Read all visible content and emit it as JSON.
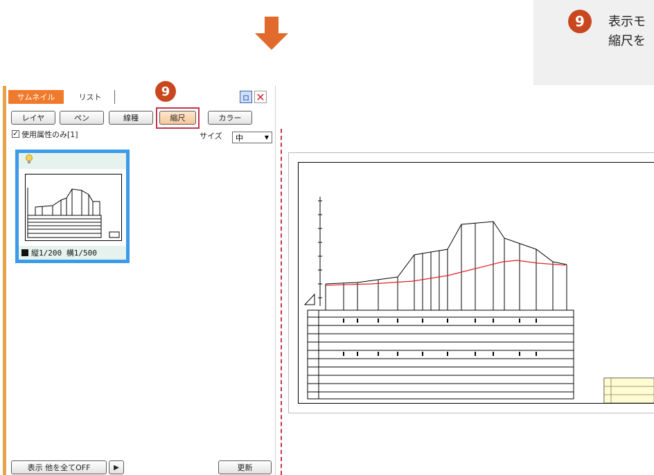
{
  "colors": {
    "accent_orange": "#e26a2c",
    "step_badge": "#c8471f",
    "highlight_red": "#c3334a",
    "thumb_border": "#3b9be8",
    "profile_red": "#dd1f26"
  },
  "callout": {
    "step_number": "9",
    "text": "表示モ\n縮尺を"
  },
  "arrow": {
    "icon": "down-arrow-icon"
  },
  "panel": {
    "tabs": [
      {
        "label": "サムネイル",
        "active": true
      },
      {
        "label": "リスト",
        "active": false
      }
    ],
    "step_marker": "9",
    "pin_label": "ロ",
    "buttons": [
      "レイヤ",
      "ペン",
      "線種",
      "縮尺",
      "カラー"
    ],
    "active_button": "縮尺",
    "filter_checkbox": {
      "checked": true,
      "label": "使用属性のみ[1]"
    },
    "size": {
      "label": "サイズ",
      "value": "中"
    },
    "thumbnail": {
      "caption": "縦1/200 横1/500",
      "icon": "lightbulb-icon"
    },
    "footer": {
      "show_button": "表示 他を全てOFF",
      "play_icon": "play-icon",
      "refresh_button": "更新"
    }
  }
}
